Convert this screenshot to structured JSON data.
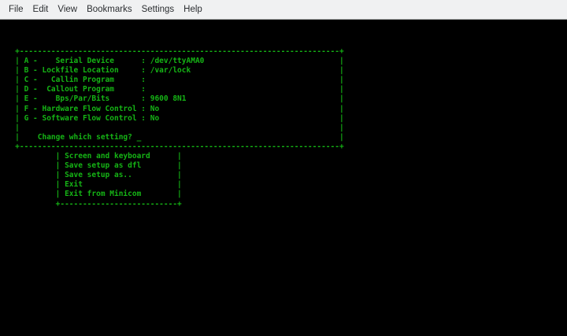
{
  "menubar": {
    "items": [
      "File",
      "Edit",
      "View",
      "Bookmarks",
      "Settings",
      "Help"
    ]
  },
  "terminal": {
    "background": "#000000",
    "foreground": "#15b415",
    "serial_setup": {
      "fields": [
        {
          "key": "A",
          "label": "Serial Device",
          "value": "/dev/ttyAMA0"
        },
        {
          "key": "B",
          "label": "Lockfile Location",
          "value": "/var/lock"
        },
        {
          "key": "C",
          "label": "Callin Program",
          "value": ""
        },
        {
          "key": "D",
          "label": "Callout Program",
          "value": ""
        },
        {
          "key": "E",
          "label": "Bps/Par/Bits",
          "value": "9600 8N1"
        },
        {
          "key": "F",
          "label": "Hardware Flow Control",
          "value": "No"
        },
        {
          "key": "G",
          "label": "Software Flow Control",
          "value": "No"
        }
      ],
      "prompt": "Change which setting?",
      "cursor": "_"
    },
    "config_menu": {
      "items": [
        "Screen and keyboard",
        "Save setup as dfl",
        "Save setup as..",
        "Exit",
        "Exit from Minicom"
      ]
    },
    "lines": [
      "   +-----------------------------------------------------------------------+",
      "   | A -    Serial Device      : /dev/ttyAMA0                              |",
      "   | B - Lockfile Location     : /var/lock                                 |",
      "   | C -   Callin Program      :                                           |",
      "   | D -  Callout Program      :                                           |",
      "   | E -    Bps/Par/Bits       : 9600 8N1                                  |",
      "   | F - Hardware Flow Control : No                                        |",
      "   | G - Software Flow Control : No                                        |",
      "   |                                                                       |",
      "   |    Change which setting? _                                            |",
      "   +-----------------------------------------------------------------------+",
      "            | Screen and keyboard      |",
      "            | Save setup as dfl        |",
      "            | Save setup as..          |",
      "            | Exit                     |",
      "            | Exit from Minicom        |",
      "            +--------------------------+"
    ]
  }
}
